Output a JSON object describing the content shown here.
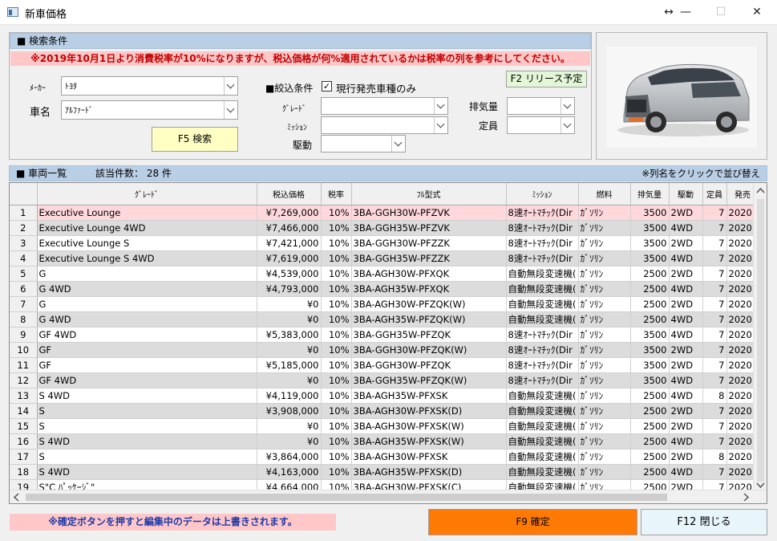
{
  "window": {
    "title": "新車価格",
    "resize_glyph": "↔",
    "minimize_glyph": "—",
    "maximize_glyph": "☐",
    "close_glyph": "✕"
  },
  "search": {
    "header": "■ 検索条件",
    "notice": "※2019年10月1日より消費税率が10%になりますが、税込価格が何%適用されているかは税率の列を参考にしてください。",
    "maker_label": "ﾒｰｶｰ",
    "maker_value": "ﾄﾖﾀ",
    "model_label": "車名",
    "model_value": "ｱﾙﾌｧｰﾄﾞ",
    "search_button": "F5 検索",
    "release_button": "F2 リリース予定",
    "filter_label": "■絞込条件",
    "current_only_label": "現行発売車種のみ",
    "current_only_checked": "✓",
    "grade_label": "ｸﾞﾚｰﾄﾞ",
    "mission_label": "ﾐｯｼｮﾝ",
    "drive_label": "駆動",
    "displacement_label": "排気量",
    "capacity_label": "定員"
  },
  "list": {
    "header": "■ 車両一覧",
    "count_label": "該当件数： 28 件",
    "sort_hint": "※列名をクリックで並び替え",
    "columns": [
      "",
      "ｸﾞﾚｰﾄﾞ",
      "税込価格",
      "税率",
      "ﾌﾙ型式",
      "ﾐｯｼｮﾝ",
      "燃料",
      "排気量",
      "駆動",
      "定員",
      "発売"
    ],
    "rows": [
      [
        "1",
        "Executive Lounge",
        "¥7,269,000",
        "10%",
        "3BA-GGH30W-PFZVK",
        "8速ｵｰﾄﾏﾁｯｸ(Dir",
        "ｶﾞｿﾘﾝ",
        "3500",
        "2WD",
        "7",
        "2020"
      ],
      [
        "2",
        "Executive Lounge 4WD",
        "¥7,466,000",
        "10%",
        "3BA-GGH35W-PFZVK",
        "8速ｵｰﾄﾏﾁｯｸ(Dir",
        "ｶﾞｿﾘﾝ",
        "3500",
        "4WD",
        "7",
        "2020"
      ],
      [
        "3",
        "Executive Lounge S",
        "¥7,421,000",
        "10%",
        "3BA-GGH30W-PFZZK",
        "8速ｵｰﾄﾏﾁｯｸ(Dir",
        "ｶﾞｿﾘﾝ",
        "3500",
        "2WD",
        "7",
        "2020"
      ],
      [
        "4",
        "Executive Lounge S 4WD",
        "¥7,619,000",
        "10%",
        "3BA-GGH35W-PFZZK",
        "8速ｵｰﾄﾏﾁｯｸ(Dir",
        "ｶﾞｿﾘﾝ",
        "3500",
        "4WD",
        "7",
        "2020"
      ],
      [
        "5",
        "G",
        "¥4,539,000",
        "10%",
        "3BA-AGH30W-PFXQK",
        "自動無段変速機(",
        "ｶﾞｿﾘﾝ",
        "2500",
        "2WD",
        "7",
        "2020"
      ],
      [
        "6",
        "G 4WD",
        "¥4,793,000",
        "10%",
        "3BA-AGH35W-PFXQK",
        "自動無段変速機(",
        "ｶﾞｿﾘﾝ",
        "2500",
        "4WD",
        "7",
        "2020"
      ],
      [
        "7",
        "G",
        "¥0",
        "10%",
        "3BA-AGH30W-PFZQK(W)",
        "自動無段変速機(",
        "ｶﾞｿﾘﾝ",
        "2500",
        "2WD",
        "7",
        "2020"
      ],
      [
        "8",
        "G 4WD",
        "¥0",
        "10%",
        "3BA-AGH35W-PFZQK(W)",
        "自動無段変速機(",
        "ｶﾞｿﾘﾝ",
        "2500",
        "4WD",
        "7",
        "2020"
      ],
      [
        "9",
        "GF 4WD",
        "¥5,383,000",
        "10%",
        "3BA-GGH35W-PFZQK",
        "8速ｵｰﾄﾏﾁｯｸ(Dir",
        "ｶﾞｿﾘﾝ",
        "3500",
        "4WD",
        "7",
        "2020"
      ],
      [
        "10",
        "GF",
        "¥0",
        "10%",
        "3BA-GGH30W-PFZQK(W)",
        "8速ｵｰﾄﾏﾁｯｸ(Dir",
        "ｶﾞｿﾘﾝ",
        "3500",
        "2WD",
        "7",
        "2020"
      ],
      [
        "11",
        "GF",
        "¥5,185,000",
        "10%",
        "3BA-GGH30W-PFZQK",
        "8速ｵｰﾄﾏﾁｯｸ(Dir",
        "ｶﾞｿﾘﾝ",
        "3500",
        "2WD",
        "7",
        "2020"
      ],
      [
        "12",
        "GF 4WD",
        "¥0",
        "10%",
        "3BA-GGH35W-PFZQK(W)",
        "8速ｵｰﾄﾏﾁｯｸ(Dir",
        "ｶﾞｿﾘﾝ",
        "3500",
        "4WD",
        "7",
        "2020"
      ],
      [
        "13",
        "S 4WD",
        "¥4,119,000",
        "10%",
        "3BA-AGH35W-PFXSK",
        "自動無段変速機(",
        "ｶﾞｿﾘﾝ",
        "2500",
        "4WD",
        "8",
        "2020"
      ],
      [
        "14",
        "S",
        "¥3,908,000",
        "10%",
        "3BA-AGH30W-PFXSK(D)",
        "自動無段変速機(",
        "ｶﾞｿﾘﾝ",
        "2500",
        "2WD",
        "7",
        "2020"
      ],
      [
        "15",
        "S",
        "¥0",
        "10%",
        "3BA-AGH30W-PFXSK(W)",
        "自動無段変速機(",
        "ｶﾞｿﾘﾝ",
        "2500",
        "2WD",
        "7",
        "2020"
      ],
      [
        "16",
        "S 4WD",
        "¥0",
        "10%",
        "3BA-AGH35W-PFXSK(W)",
        "自動無段変速機(",
        "ｶﾞｿﾘﾝ",
        "2500",
        "4WD",
        "7",
        "2020"
      ],
      [
        "17",
        "S",
        "¥3,864,000",
        "10%",
        "3BA-AGH30W-PFXSK",
        "自動無段変速機(",
        "ｶﾞｿﾘﾝ",
        "2500",
        "2WD",
        "8",
        "2020"
      ],
      [
        "18",
        "S 4WD",
        "¥4,163,000",
        "10%",
        "3BA-AGH35W-PFXSK(D)",
        "自動無段変速機(",
        "ｶﾞｿﾘﾝ",
        "2500",
        "4WD",
        "7",
        "2020"
      ],
      [
        "19",
        "S\"C ﾊﾟｯｹｰｼﾞ\"",
        "¥4,664,000",
        "10%",
        "3BA-AGH30W-PFXSK(C)",
        "自動無段変速機(",
        "ｶﾞｿﾘﾝ",
        "2500",
        "2WD",
        "7",
        "2020"
      ]
    ]
  },
  "footer": {
    "warning": "※確定ボタンを押すと編集中のデータは上書きされます。",
    "confirm_button": "F9 確定",
    "close_button": "F12 閉じる"
  },
  "colors": {
    "confirm": "#ff7a05",
    "close": "#e8f5fb",
    "search": "#ffffc4",
    "release": "#e4f6d8",
    "notice_bg": "#ffc7c7"
  }
}
